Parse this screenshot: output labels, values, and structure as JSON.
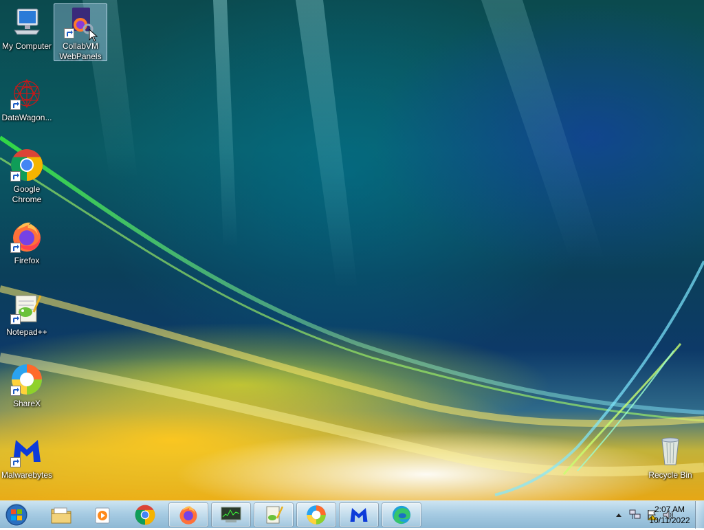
{
  "desktop": {
    "icons": [
      {
        "label": "My Computer",
        "icon": "computer-icon",
        "shortcut": false
      },
      {
        "label": "CollabVM WebPanels",
        "icon": "collabvm-webpanels-icon",
        "shortcut": true,
        "selected": true
      },
      {
        "label": "DataWagon...",
        "icon": "datawagon-icon",
        "shortcut": true
      },
      {
        "label": "Google Chrome",
        "icon": "chrome-icon",
        "shortcut": true
      },
      {
        "label": "Firefox",
        "icon": "firefox-icon",
        "shortcut": true
      },
      {
        "label": "Notepad++",
        "icon": "notepadpp-icon",
        "shortcut": true
      },
      {
        "label": "ShareX",
        "icon": "sharex-icon",
        "shortcut": true
      },
      {
        "label": "Malwarebytes",
        "icon": "malwarebytes-icon",
        "shortcut": true
      },
      {
        "label": "Recycle Bin",
        "icon": "recycle-bin-icon",
        "shortcut": false
      }
    ]
  },
  "taskbar": {
    "start": {
      "icon": "windows-orb-icon"
    },
    "buttons": [
      {
        "icon": "explorer-icon",
        "open": false
      },
      {
        "icon": "media-player-icon",
        "open": false
      },
      {
        "icon": "chrome-icon",
        "open": false
      },
      {
        "icon": "firefox-icon",
        "open": true
      },
      {
        "icon": "task-manager-icon",
        "open": true
      },
      {
        "icon": "notepadpp-icon",
        "open": true
      },
      {
        "icon": "sharex-icon",
        "open": true
      },
      {
        "icon": "malwarebytes-icon",
        "open": true
      },
      {
        "icon": "edge-icon",
        "open": true
      }
    ],
    "tray": {
      "icons": [
        "show-hidden-icons-arrow",
        "network-icon",
        "action-center-flag-icon",
        "volume-icon"
      ],
      "time": "2:07 AM",
      "date": "10/11/2022"
    }
  },
  "colors": {
    "taskbar": "#a8cbe2",
    "chrome_red": "#db4437",
    "chrome_green": "#0f9d58",
    "chrome_yellow": "#f4b400",
    "chrome_blue": "#4285f4",
    "malwarebytes_blue": "#0d3bd9"
  }
}
